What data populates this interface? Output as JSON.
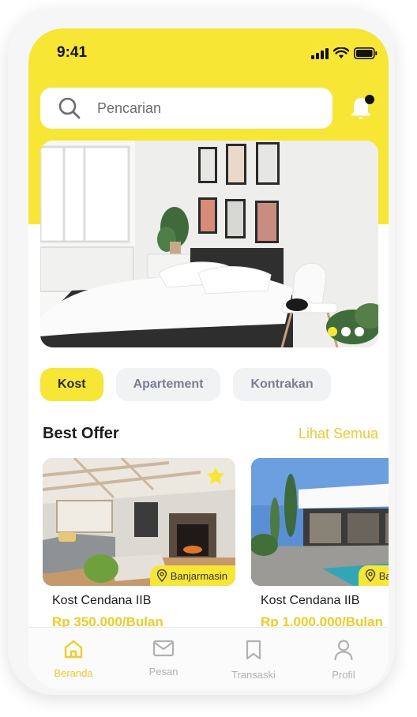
{
  "status_bar": {
    "time": "9:41"
  },
  "search": {
    "placeholder": "Pencarian"
  },
  "banner": {
    "slides": 3,
    "active_slide": 1
  },
  "categories": [
    {
      "label": "Kost",
      "active": true
    },
    {
      "label": "Apartement",
      "active": false
    },
    {
      "label": "Kontrakan",
      "active": false
    }
  ],
  "best_offer": {
    "title": "Best Offer",
    "see_all": "Lihat Semua",
    "items": [
      {
        "name": "Kost Cendana IIB",
        "price": "Rp 350.000/Bulan",
        "location": "Banjarmasin",
        "favorite": true
      },
      {
        "name": "Kost Cendana IIB",
        "price": "Rp 1.000.000/Bulan",
        "location": "Banjarmasin",
        "favorite": false
      }
    ]
  },
  "nav": [
    {
      "label": "Beranda",
      "icon": "home-icon",
      "active": true
    },
    {
      "label": "Pesan",
      "icon": "mail-icon",
      "active": false
    },
    {
      "label": "Transaski",
      "icon": "bookmark-icon",
      "active": false
    },
    {
      "label": "Profil",
      "icon": "user-icon",
      "active": false
    }
  ],
  "colors": {
    "accent": "#f8e634",
    "accent_text": "#f0cc24",
    "chip_bg": "#f1f2f4",
    "chip_text": "#7a7f8f"
  }
}
